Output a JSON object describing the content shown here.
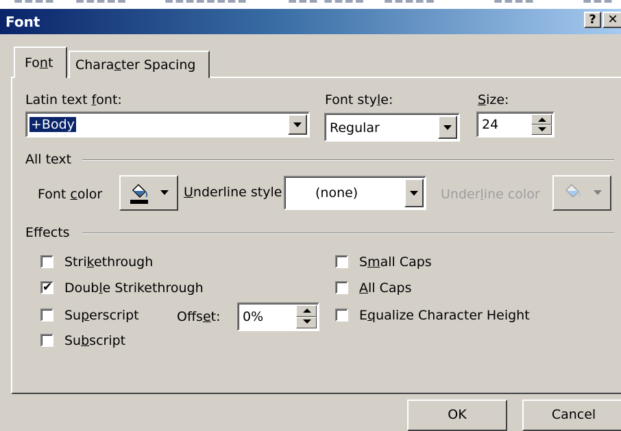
{
  "dialog": {
    "title": "Font",
    "help_label": "?",
    "close_label": "✕"
  },
  "tabs": [
    {
      "pre": "Fo",
      "key": "n",
      "post": "t",
      "active": true
    },
    {
      "pre": "Chara",
      "key": "c",
      "post": "ter Spacing",
      "active": false
    }
  ],
  "latin_font": {
    "label_pre": "Latin text ",
    "label_key": "f",
    "label_post": "ont:",
    "value": "+Body"
  },
  "font_style": {
    "label_pre": "Font sty",
    "label_key": "l",
    "label_post": "e:",
    "value": "Regular"
  },
  "size": {
    "label_pre": "",
    "label_key": "S",
    "label_post": "ize:",
    "value": "24"
  },
  "all_text": {
    "header": "All text",
    "font_color": {
      "pre": "Font ",
      "key": "c",
      "post": "olor",
      "color": "#000000"
    },
    "underline_style": {
      "pre": "",
      "key": "U",
      "post": "nderline style",
      "value": "(none)"
    },
    "underline_color": {
      "pre": "Under",
      "key": "l",
      "post": "ine color",
      "enabled": false
    }
  },
  "effects": {
    "header": "Effects",
    "offset": {
      "pre": "Offs",
      "key": "e",
      "post": "t:",
      "value": "0%"
    },
    "left": [
      {
        "pre": "Stri",
        "key": "k",
        "post": "ethrough",
        "checked": false
      },
      {
        "pre": "Doub",
        "key": "l",
        "post": "e Strikethrough",
        "checked": true
      },
      {
        "pre": "Su",
        "key": "p",
        "post": "erscript",
        "checked": false
      },
      {
        "pre": "Su",
        "key": "b",
        "post": "script",
        "checked": false
      }
    ],
    "right": [
      {
        "pre": "S",
        "key": "m",
        "post": "all Caps",
        "checked": false
      },
      {
        "pre": "",
        "key": "A",
        "post": "ll Caps",
        "checked": false
      },
      {
        "pre": "E",
        "key": "q",
        "post": "ualize Character Height",
        "checked": false
      }
    ]
  },
  "buttons": {
    "ok": "OK",
    "cancel": "Cancel"
  },
  "icons": {
    "paint_bucket": "paint-bucket-icon",
    "arrow": "chevron-down-icon",
    "help": "help-icon",
    "close": "close-icon"
  }
}
